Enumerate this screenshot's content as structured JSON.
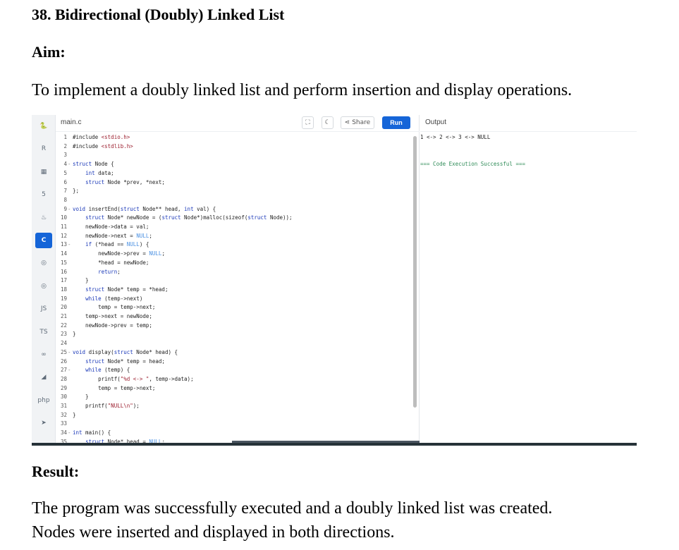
{
  "document": {
    "title": "38. Bidirectional (Doubly) Linked List",
    "aim_heading": "Aim:",
    "aim_text": "To implement a doubly linked list and perform insertion and display operations.",
    "result_heading": "Result:",
    "result_lines": [
      "The program was successfully executed and a doubly linked list was created.",
      "Nodes were inserted and displayed in both directions."
    ]
  },
  "ide": {
    "file_tab": "main.c",
    "share_label": "Share",
    "run_label": "Run",
    "output_title": "Output",
    "output_lines": [
      "1 <-> 2 <-> 3 <-> NULL",
      "=== Code Execution Successful ==="
    ],
    "language_icons": [
      "python-icon",
      "r-icon",
      "sql-icon",
      "html-icon",
      "java-icon",
      "c-icon",
      "cpp-icon",
      "csharp-icon",
      "js-icon",
      "ts-icon",
      "go-icon",
      "kotlin-icon",
      "php-icon",
      "swift-icon"
    ],
    "language_labels": [
      "",
      "R",
      "",
      "5",
      "",
      "C",
      "",
      "",
      "JS",
      "TS",
      "",
      "",
      "php",
      ""
    ],
    "active_language": "c-icon",
    "code_lines": [
      {
        "n": "1",
        "fold": "",
        "code": "#include <stdio.h>"
      },
      {
        "n": "2",
        "fold": "",
        "code": "#include <stdlib.h>"
      },
      {
        "n": "3",
        "fold": "",
        "code": ""
      },
      {
        "n": "4",
        "fold": "-",
        "code": "struct Node {"
      },
      {
        "n": "5",
        "fold": "",
        "code": "    int data;"
      },
      {
        "n": "6",
        "fold": "",
        "code": "    struct Node *prev, *next;"
      },
      {
        "n": "7",
        "fold": "",
        "code": "};"
      },
      {
        "n": "8",
        "fold": "",
        "code": ""
      },
      {
        "n": "9",
        "fold": "-",
        "code": "void insertEnd(struct Node** head, int val) {"
      },
      {
        "n": "10",
        "fold": "",
        "code": "    struct Node* newNode = (struct Node*)malloc(sizeof(struct Node));"
      },
      {
        "n": "11",
        "fold": "",
        "code": "    newNode->data = val;"
      },
      {
        "n": "12",
        "fold": "",
        "code": "    newNode->next = NULL;"
      },
      {
        "n": "13",
        "fold": "-",
        "code": "    if (*head == NULL) {"
      },
      {
        "n": "14",
        "fold": "",
        "code": "        newNode->prev = NULL;"
      },
      {
        "n": "15",
        "fold": "",
        "code": "        *head = newNode;"
      },
      {
        "n": "16",
        "fold": "",
        "code": "        return;"
      },
      {
        "n": "17",
        "fold": "",
        "code": "    }"
      },
      {
        "n": "18",
        "fold": "",
        "code": "    struct Node* temp = *head;"
      },
      {
        "n": "19",
        "fold": "",
        "code": "    while (temp->next)"
      },
      {
        "n": "20",
        "fold": "",
        "code": "        temp = temp->next;"
      },
      {
        "n": "21",
        "fold": "",
        "code": "    temp->next = newNode;"
      },
      {
        "n": "22",
        "fold": "",
        "code": "    newNode->prev = temp;"
      },
      {
        "n": "23",
        "fold": "",
        "code": "}"
      },
      {
        "n": "24",
        "fold": "",
        "code": ""
      },
      {
        "n": "25",
        "fold": "-",
        "code": "void display(struct Node* head) {"
      },
      {
        "n": "26",
        "fold": "",
        "code": "    struct Node* temp = head;"
      },
      {
        "n": "27",
        "fold": "-",
        "code": "    while (temp) {"
      },
      {
        "n": "28",
        "fold": "",
        "code": "        printf(\"%d <-> \", temp->data);"
      },
      {
        "n": "29",
        "fold": "",
        "code": "        temp = temp->next;"
      },
      {
        "n": "30",
        "fold": "",
        "code": "    }"
      },
      {
        "n": "31",
        "fold": "",
        "code": "    printf(\"NULL\\n\");"
      },
      {
        "n": "32",
        "fold": "",
        "code": "}"
      },
      {
        "n": "33",
        "fold": "",
        "code": ""
      },
      {
        "n": "34",
        "fold": "-",
        "code": "int main() {"
      },
      {
        "n": "35",
        "fold": "",
        "code": "    struct Node* head = NULL;"
      }
    ]
  },
  "colors": {
    "accent": "#1565d8",
    "success": "#2e8b57"
  }
}
